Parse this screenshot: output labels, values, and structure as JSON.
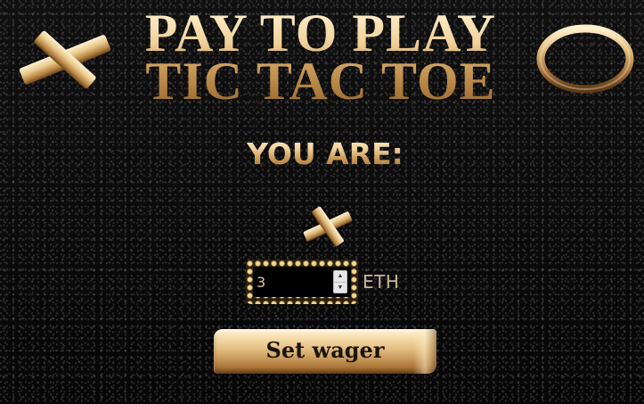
{
  "title": {
    "line1": "PAY TO PLAY",
    "line2": "TIC TAC TOE"
  },
  "decorations": {
    "left_icon": "gold-x-icon",
    "right_icon": "gold-ring-o-icon"
  },
  "player": {
    "label": "YOU ARE:",
    "mark": "X",
    "mark_icon": "gold-x-icon"
  },
  "wager": {
    "value": "3",
    "currency": "ETH",
    "stepper_up": "▲",
    "stepper_down": "▼"
  },
  "actions": {
    "set_wager_label": "Set wager"
  },
  "colors": {
    "background": "#0b0b0b",
    "gold_light": "#f7dfae",
    "gold_dark": "#a97436",
    "button_text": "#1a140c"
  }
}
